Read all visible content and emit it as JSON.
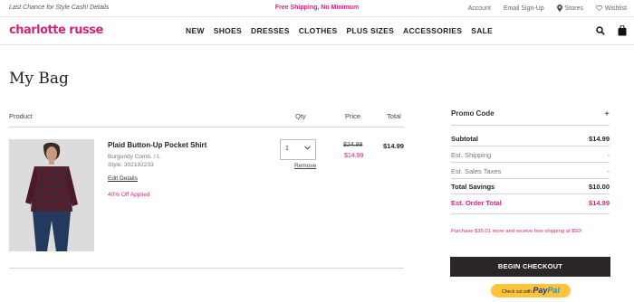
{
  "promo_bar": {
    "left_text": "Last Chance for Style Cash! Details",
    "center_text": "Free Shipping, No Minimum",
    "account": "Account",
    "email_signup": "Email Sign-Up",
    "stores": "Stores",
    "wishlist": "Wishlist"
  },
  "header": {
    "logo": "charlotte russe",
    "nav": [
      "NEW",
      "SHOES",
      "DRESSES",
      "CLOTHES",
      "PLUS SIZES",
      "ACCESSORIES",
      "SALE"
    ],
    "icons": [
      "search-icon",
      "bag-icon"
    ]
  },
  "page": {
    "title": "My Bag"
  },
  "table_headers": {
    "product": "Product",
    "qty": "Qty",
    "price": "Price",
    "total": "Total"
  },
  "item": {
    "name": "Plaid Button-Up Pocket Shirt",
    "color_size": "Burgundy Comb. / L",
    "style": "Style: 302192233",
    "edit_label": "Edit Details",
    "discount_note": "40% Off Applied",
    "qty": "1",
    "remove_label": "Remove",
    "price_original": "$24.99",
    "price_sale": "$14.99",
    "total": "$14.99"
  },
  "summary": {
    "promo_code_label": "Promo Code",
    "promo_toggle": "+",
    "subtotal_label": "Subtotal",
    "subtotal_value": "$14.99",
    "shipping_label": "Est. Shipping",
    "shipping_value": "-",
    "tax_label": "Est. Sales Taxes",
    "tax_value": "-",
    "savings_label": "Total Savings",
    "savings_value": "$10.00",
    "order_total_label": "Est. Order Total",
    "order_total_value": "$14.99",
    "shipping_note": "Purchase $35.01 more and receive free shipping at $50!",
    "checkout_label": "BEGIN CHECKOUT",
    "paypal_prefix": "Check out with",
    "paypal_brand_a": "Pay",
    "paypal_brand_b": "Pal"
  },
  "colors": {
    "brand_pink": "#d0267a",
    "dark_button": "#2a2526",
    "paypal_yellow": "#ffc439"
  }
}
